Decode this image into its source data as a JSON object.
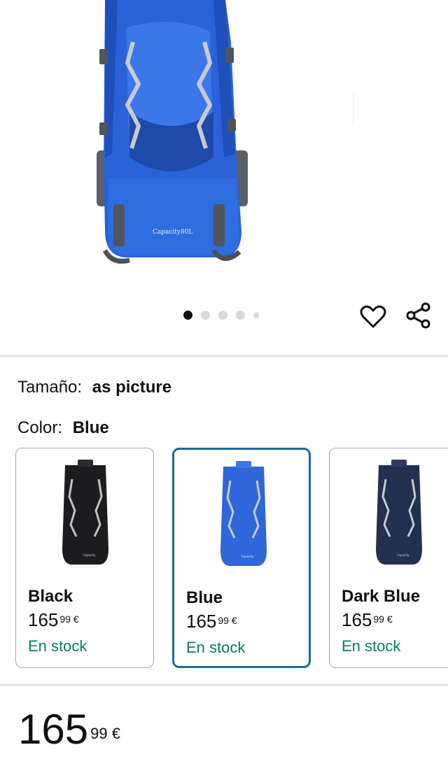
{
  "product_image": {
    "label": "Capacity80L",
    "carousel": {
      "count": 5,
      "active_index": 0
    }
  },
  "actions": {
    "wishlist_icon": "heart-icon",
    "share_icon": "share-icon"
  },
  "size": {
    "label": "Tamaño:",
    "value": "as picture"
  },
  "color": {
    "label": "Color:",
    "value": "Blue"
  },
  "swatches": [
    {
      "name": "Black",
      "price_whole": "165",
      "price_fraction": "99 €",
      "stock": "En stock",
      "selected": false,
      "color_hex": "#1c1c1e"
    },
    {
      "name": "Blue",
      "price_whole": "165",
      "price_fraction": "99 €",
      "stock": "En stock",
      "selected": true,
      "color_hex": "#2f66d9"
    },
    {
      "name": "Dark Blue",
      "price_whole": "165",
      "price_fraction": "99 €",
      "stock": "En stock",
      "selected": false,
      "color_hex": "#23304f"
    }
  ],
  "price": {
    "whole": "165",
    "fraction": "99 €"
  },
  "colors": {
    "accent_border": "#1b6a9c",
    "stock_green": "#067d62",
    "divider": "#e7e9ec"
  }
}
